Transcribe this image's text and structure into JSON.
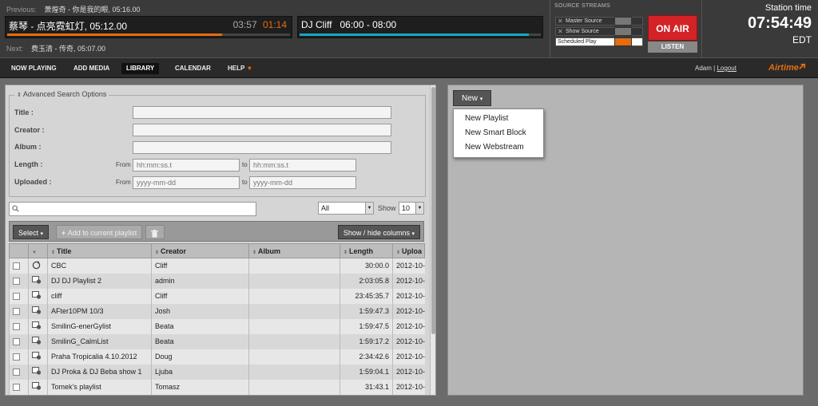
{
  "header": {
    "previous_label": "Previous:",
    "previous_track": "萧煌奇 - 你是我的眼, 05:16.00",
    "current_title": "蔡琴 - 点亮霓虹灯, 05:12.00",
    "current_elapsed": "03:57",
    "current_remaining": "01:14",
    "current_progress": 0.76,
    "show_title": "DJ Cliff",
    "show_time": "06:00 - 08:00",
    "show_progress": 0.95,
    "next_label": "Next:",
    "next_track": "费玉清 - 传奇, 05:07.00",
    "accent_color": "#e46d10",
    "show_bar_color": "#18a6c4"
  },
  "source_streams": {
    "heading": "SOURCE STREAMS",
    "master": "Master Source",
    "show": "Show Source",
    "scheduled": "Scheduled Play",
    "on_air": "ON AIR",
    "listen": "LISTEN"
  },
  "clock": {
    "label": "Station time",
    "time": "07:54:49",
    "tz": "EDT"
  },
  "nav": {
    "now_playing": "NOW PLAYING",
    "add_media": "ADD MEDIA",
    "library": "LIBRARY",
    "calendar": "CALENDAR",
    "help": "HELP",
    "user": "Adam",
    "sep": "|",
    "logout": "Logout",
    "brand": "Airtime"
  },
  "search": {
    "legend": "Advanced Search Options",
    "title_label": "Title :",
    "creator_label": "Creator :",
    "album_label": "Album :",
    "length_label": "Length :",
    "uploaded_label": "Uploaded :",
    "from": "From",
    "to": "to",
    "length_placeholder": "hh:mm:ss.t",
    "date_placeholder": "yyyy-mm-dd",
    "type_value": "All",
    "show_label": "Show",
    "show_value": "10"
  },
  "toolbar": {
    "select": "Select",
    "add_to_playlist": "Add to current playlist",
    "show_hide": "Show / hide columns"
  },
  "table": {
    "headers": [
      "Title",
      "Creator",
      "Album",
      "Length",
      "Uploa"
    ],
    "rows": [
      {
        "title": "CBC",
        "creator": "Cliff",
        "album": "",
        "length": "30:00.0",
        "uploaded": "2012-10-",
        "icon": "webstream-icon"
      },
      {
        "title": "DJ DJ Playlist 2",
        "creator": "admin",
        "album": "",
        "length": "2:03:05.8",
        "uploaded": "2012-10-",
        "icon": "playlist-icon"
      },
      {
        "title": "cliff",
        "creator": "Cliff",
        "album": "",
        "length": "23:45:35.7",
        "uploaded": "2012-10-",
        "icon": "playlist-icon"
      },
      {
        "title": "AFter10PM 10/3",
        "creator": "Josh",
        "album": "",
        "length": "1:59:47.3",
        "uploaded": "2012-10-",
        "icon": "playlist-icon"
      },
      {
        "title": "SmilinG-enerGylist",
        "creator": "Beata",
        "album": "",
        "length": "1:59:47.5",
        "uploaded": "2012-10-",
        "icon": "playlist-icon"
      },
      {
        "title": "SmilinG_CalmList",
        "creator": "Beata",
        "album": "",
        "length": "1:59:17.2",
        "uploaded": "2012-10-",
        "icon": "playlist-icon"
      },
      {
        "title": "Praha Tropicalia 4.10.2012",
        "creator": "Doug",
        "album": "",
        "length": "2:34:42.6",
        "uploaded": "2012-10-",
        "icon": "playlist-icon"
      },
      {
        "title": "DJ Proka & DJ Beba show 1",
        "creator": "Ljuba",
        "album": "",
        "length": "1:59:04.1",
        "uploaded": "2012-10-",
        "icon": "playlist-icon"
      },
      {
        "title": "Tomek's playlist",
        "creator": "Tomasz",
        "album": "",
        "length": "31:43.1",
        "uploaded": "2012-10-",
        "icon": "playlist-icon"
      }
    ]
  },
  "right": {
    "new_button": "New",
    "menu": [
      "New Playlist",
      "New Smart Block",
      "New Webstream"
    ]
  }
}
